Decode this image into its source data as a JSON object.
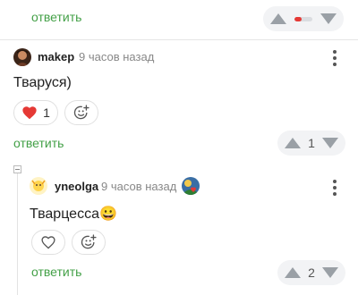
{
  "colors": {
    "accent_green": "#43a047",
    "heart_red": "#e53935",
    "pill_bg": "#f2f3f5"
  },
  "top_comment_footer": {
    "reply_label": "ответить",
    "rating_fraction": 0.4
  },
  "comment1": {
    "username": "makep",
    "time": "9 часов назад",
    "text": "Тваруся)",
    "like_count": "1",
    "reply_label": "ответить",
    "vote_count": "1",
    "icons": [
      "heart-icon",
      "add-emoji-icon",
      "more-vertical-icon",
      "thumb-up-icon",
      "thumb-down-icon"
    ]
  },
  "comment2": {
    "username": "yneolga",
    "time": "9 часов назад",
    "text": "Тварцесса😀",
    "reply_label": "ответить",
    "vote_count": "2",
    "icons": [
      "heart-outline-icon",
      "add-emoji-icon",
      "more-vertical-icon",
      "award-badge-icon"
    ]
  }
}
